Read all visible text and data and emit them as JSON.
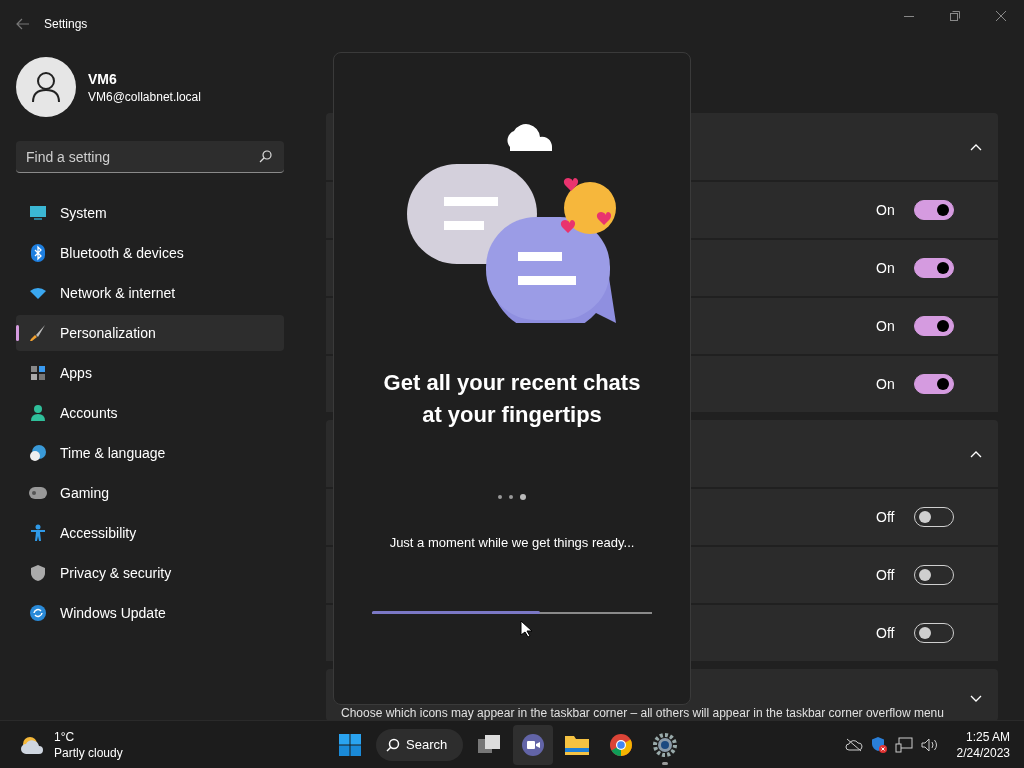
{
  "window": {
    "title": "Settings"
  },
  "profile": {
    "name": "VM6",
    "email": "VM6@collabnet.local"
  },
  "search": {
    "placeholder": "Find a setting"
  },
  "sidebar": {
    "items": [
      {
        "label": "System",
        "selected": false
      },
      {
        "label": "Bluetooth & devices",
        "selected": false
      },
      {
        "label": "Network & internet",
        "selected": false
      },
      {
        "label": "Personalization",
        "selected": true
      },
      {
        "label": "Apps",
        "selected": false
      },
      {
        "label": "Accounts",
        "selected": false
      },
      {
        "label": "Time & language",
        "selected": false
      },
      {
        "label": "Gaming",
        "selected": false
      },
      {
        "label": "Accessibility",
        "selected": false
      },
      {
        "label": "Privacy & security",
        "selected": false
      },
      {
        "label": "Windows Update",
        "selected": false
      }
    ]
  },
  "page": {
    "groups": [
      {
        "expanded": true,
        "rows": [
          {
            "state_text": "On",
            "on": true
          },
          {
            "state_text": "On",
            "on": true
          },
          {
            "state_text": "On",
            "on": true
          },
          {
            "state_text": "On",
            "on": true
          }
        ]
      },
      {
        "expanded": true,
        "rows": [
          {
            "state_text": "Off",
            "on": false
          },
          {
            "state_text": "Off",
            "on": false
          },
          {
            "state_text": "Off",
            "on": false
          }
        ]
      },
      {
        "expanded": false,
        "description": "Choose which icons may appear in the taskbar corner – all others will appear in the taskbar corner overflow menu"
      }
    ]
  },
  "chat_flyout": {
    "title": "Get all your recent chats at your fingertips",
    "message": "Just a moment while we get things ready...",
    "progress": {
      "level": 0.6
    }
  },
  "taskbar": {
    "weather": {
      "temperature": "1°C",
      "condition": "Partly cloudy"
    },
    "search_label": "Search",
    "apps": [
      {
        "kind": "taskview",
        "selected": false,
        "running": false
      },
      {
        "kind": "chat",
        "selected": true,
        "running": false
      },
      {
        "kind": "explorer",
        "selected": false,
        "running": false
      },
      {
        "kind": "browser",
        "selected": false,
        "running": false
      },
      {
        "kind": "settings",
        "selected": false,
        "running": true
      }
    ],
    "clock": {
      "time": "1:25 AM",
      "date": "2/24/2023"
    }
  }
}
